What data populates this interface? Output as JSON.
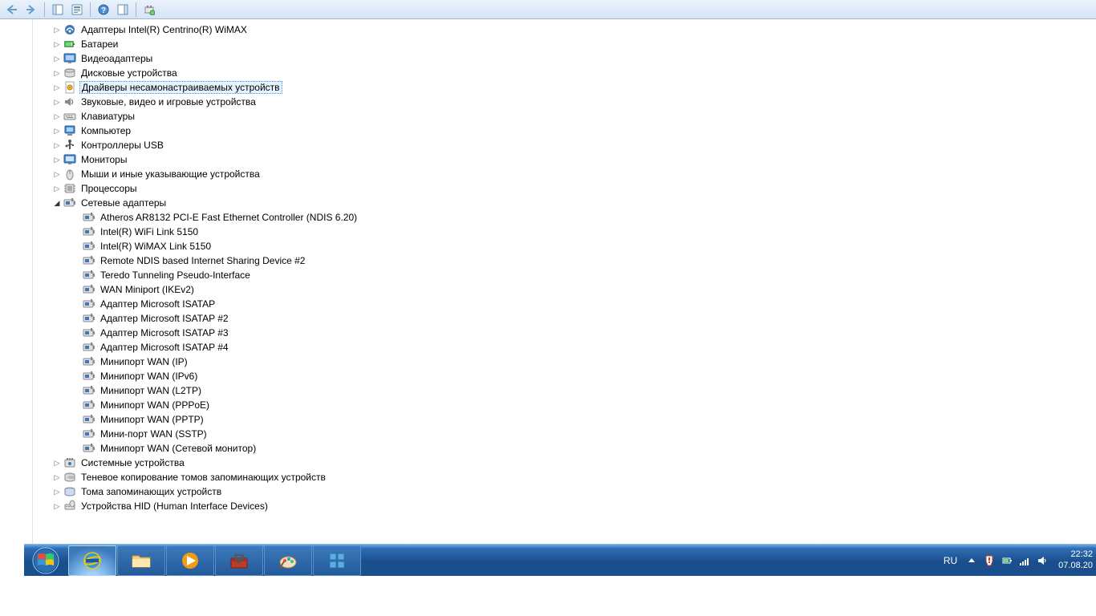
{
  "toolbar": {
    "back": "back",
    "forward": "forward",
    "show_hide_tree": "tree",
    "properties": "props",
    "help": "help",
    "actions": "actions",
    "extra": "extra"
  },
  "categories": [
    {
      "label": "Адаптеры Intel(R) Centrino(R) WiMAX",
      "icon": "wimax",
      "expander": "collapsed"
    },
    {
      "label": "Батареи",
      "icon": "battery",
      "expander": "collapsed"
    },
    {
      "label": "Видеоадаптеры",
      "icon": "display",
      "expander": "collapsed"
    },
    {
      "label": "Дисковые устройства",
      "icon": "disk",
      "expander": "collapsed"
    },
    {
      "label": "Драйверы несамонастраиваемых устройств",
      "icon": "gear-doc",
      "expander": "collapsed",
      "selected": true
    },
    {
      "label": "Звуковые, видео и игровые устройства",
      "icon": "sound",
      "expander": "collapsed"
    },
    {
      "label": "Клавиатуры",
      "icon": "keyboard",
      "expander": "collapsed"
    },
    {
      "label": "Компьютер",
      "icon": "computer",
      "expander": "collapsed"
    },
    {
      "label": "Контроллеры USB",
      "icon": "usb",
      "expander": "collapsed"
    },
    {
      "label": "Мониторы",
      "icon": "monitor",
      "expander": "collapsed"
    },
    {
      "label": "Мыши и иные указывающие устройства",
      "icon": "mouse",
      "expander": "collapsed"
    },
    {
      "label": "Процессоры",
      "icon": "cpu",
      "expander": "collapsed"
    },
    {
      "label": "Сетевые адаптеры",
      "icon": "network",
      "expander": "expanded",
      "children": [
        {
          "label": "Atheros AR8132 PCI-E Fast Ethernet Controller (NDIS 6.20)",
          "icon": "nic"
        },
        {
          "label": "Intel(R) WiFi Link 5150",
          "icon": "nic"
        },
        {
          "label": "Intel(R) WiMAX Link 5150",
          "icon": "nic"
        },
        {
          "label": "Remote NDIS based Internet Sharing Device #2",
          "icon": "nic"
        },
        {
          "label": "Teredo Tunneling Pseudo-Interface",
          "icon": "nic"
        },
        {
          "label": "WAN Miniport (IKEv2)",
          "icon": "nic"
        },
        {
          "label": "Адаптер Microsoft ISATAP",
          "icon": "nic"
        },
        {
          "label": "Адаптер Microsoft ISATAP #2",
          "icon": "nic"
        },
        {
          "label": "Адаптер Microsoft ISATAP #3",
          "icon": "nic"
        },
        {
          "label": "Адаптер Microsoft ISATAP #4",
          "icon": "nic"
        },
        {
          "label": "Минипорт WAN (IP)",
          "icon": "nic"
        },
        {
          "label": "Минипорт WAN (IPv6)",
          "icon": "nic"
        },
        {
          "label": "Минипорт WAN (L2TP)",
          "icon": "nic"
        },
        {
          "label": "Минипорт WAN (PPPoE)",
          "icon": "nic"
        },
        {
          "label": "Минипорт WAN (PPTP)",
          "icon": "nic"
        },
        {
          "label": "Мини-порт WAN (SSTP)",
          "icon": "nic"
        },
        {
          "label": "Минипорт WAN (Сетевой монитор)",
          "icon": "nic"
        }
      ]
    },
    {
      "label": "Системные устройства",
      "icon": "system",
      "expander": "collapsed"
    },
    {
      "label": "Теневое копирование томов запоминающих устройств",
      "icon": "shadow",
      "expander": "collapsed"
    },
    {
      "label": "Тома запоминающих устройств",
      "icon": "volume",
      "expander": "collapsed"
    },
    {
      "label": "Устройства HID (Human Interface Devices)",
      "icon": "hid",
      "expander": "collapsed"
    }
  ],
  "taskbar": {
    "lang": "RU",
    "time": "22:32",
    "date": "07.08.20"
  }
}
